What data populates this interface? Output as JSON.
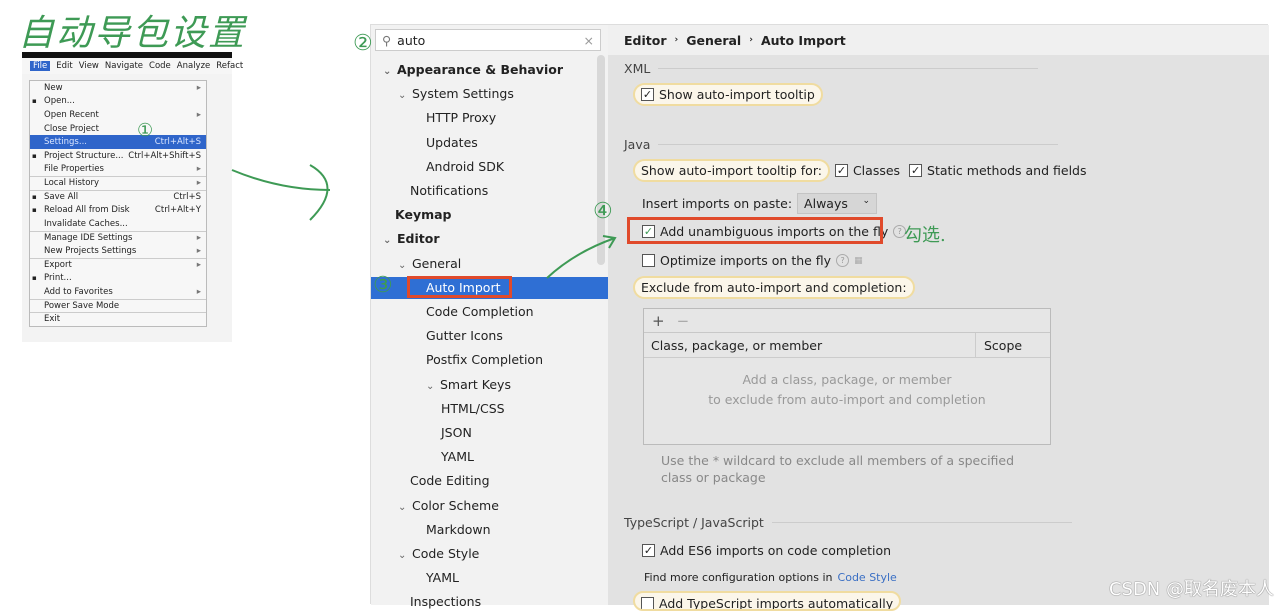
{
  "annotations": {
    "title": "自动导包设置",
    "step1": "①",
    "step2": "②",
    "step3": "③",
    "step4": "④",
    "check_note": "勾选."
  },
  "file_menu": {
    "menubar": [
      "File",
      "Edit",
      "View",
      "Navigate",
      "Code",
      "Analyze",
      "Refact"
    ],
    "items": [
      {
        "label": "New",
        "shortcut": "",
        "submenu": true
      },
      {
        "label": "Open...",
        "shortcut": "",
        "icon": "folder-icon"
      },
      {
        "label": "Open Recent",
        "shortcut": "",
        "submenu": true
      },
      {
        "label": "Close Project",
        "shortcut": ""
      },
      {
        "label": "Settings...",
        "shortcut": "Ctrl+Alt+S",
        "selected": true
      },
      {
        "label": "Project Structure...",
        "shortcut": "Ctrl+Alt+Shift+S",
        "icon": "project-structure-icon"
      },
      {
        "label": "File Properties",
        "shortcut": "",
        "submenu": true
      },
      {
        "label": "Local History",
        "shortcut": "",
        "submenu": true,
        "sep": true
      },
      {
        "label": "Save All",
        "shortcut": "Ctrl+S",
        "icon": "save-icon",
        "sep": true
      },
      {
        "label": "Reload All from Disk",
        "shortcut": "Ctrl+Alt+Y",
        "icon": "reload-icon"
      },
      {
        "label": "Invalidate Caches...",
        "shortcut": ""
      },
      {
        "label": "Manage IDE Settings",
        "shortcut": "",
        "submenu": true,
        "sep": true
      },
      {
        "label": "New Projects Settings",
        "shortcut": "",
        "submenu": true
      },
      {
        "label": "Export",
        "shortcut": "",
        "submenu": true,
        "sep": true
      },
      {
        "label": "Print...",
        "shortcut": "",
        "icon": "print-icon"
      },
      {
        "label": "Add to Favorites",
        "shortcut": "",
        "submenu": true
      },
      {
        "label": "Power Save Mode",
        "shortcut": "",
        "sep": true
      },
      {
        "label": "Exit",
        "shortcut": "",
        "sep": true
      }
    ]
  },
  "search": {
    "value": "auto"
  },
  "tree": [
    {
      "label": "Appearance & Behavior",
      "level": 0,
      "bold": true,
      "chevron": true
    },
    {
      "label": "System Settings",
      "level": 1,
      "chevron": true
    },
    {
      "label": "HTTP Proxy",
      "level": 2
    },
    {
      "label": "Updates",
      "level": 2
    },
    {
      "label": "Android SDK",
      "level": 2
    },
    {
      "label": "Notifications",
      "level": 1
    },
    {
      "label": "Keymap",
      "level": 0,
      "bold": true
    },
    {
      "label": "Editor",
      "level": 0,
      "bold": true,
      "chevron": true
    },
    {
      "label": "General",
      "level": 1,
      "chevron": true
    },
    {
      "label": "Auto Import",
      "level": 2,
      "selected": true
    },
    {
      "label": "Code Completion",
      "level": 2
    },
    {
      "label": "Gutter Icons",
      "level": 2
    },
    {
      "label": "Postfix Completion",
      "level": 2
    },
    {
      "label": "Smart Keys",
      "level": 2,
      "chevron": true
    },
    {
      "label": "HTML/CSS",
      "level": 3
    },
    {
      "label": "JSON",
      "level": 3
    },
    {
      "label": "YAML",
      "level": 3
    },
    {
      "label": "Code Editing",
      "level": 1
    },
    {
      "label": "Color Scheme",
      "level": 1,
      "chevron": true
    },
    {
      "label": "Markdown",
      "level": 2
    },
    {
      "label": "Code Style",
      "level": 1,
      "chevron": true
    },
    {
      "label": "YAML",
      "level": 2
    },
    {
      "label": "Inspections",
      "level": 1
    }
  ],
  "breadcrumb": [
    "Editor",
    "General",
    "Auto Import"
  ],
  "xml": {
    "section": "XML",
    "show_tooltip": "Show auto-import tooltip"
  },
  "java": {
    "section": "Java",
    "tooltip_for": "Show auto-import tooltip for:",
    "classes": "Classes",
    "static": "Static methods and fields",
    "insert_label": "Insert imports on paste:",
    "insert_value": "Always",
    "add_unambiguous": "Add unambiguous imports on the fly",
    "optimize": "Optimize imports on the fly",
    "exclude_label": "Exclude from auto-import and completion:",
    "table": {
      "add": "+",
      "remove": "−",
      "col1": "Class, package, or member",
      "col2": "Scope",
      "empty1": "Add a class, package, or member",
      "empty2": "to exclude from auto-import and completion"
    },
    "hint": "Use the * wildcard to exclude all members of a specified class or package"
  },
  "ts": {
    "section": "TypeScript / JavaScript",
    "es6": "Add ES6 imports on code completion",
    "more": "Find more configuration options in",
    "link": "Code Style",
    "cut": "Add TypeScript imports automatically"
  },
  "watermark": "CSDN @取名废本人",
  "colors": {
    "selection": "#2f6fd4",
    "highlight_box": "#e04a2b",
    "annotation": "#3e9a55"
  }
}
